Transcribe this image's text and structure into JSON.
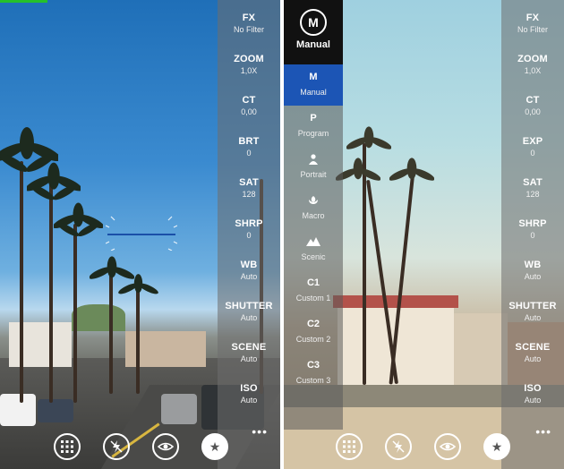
{
  "left_screen": {
    "settings": [
      {
        "label": "FX",
        "value": "No Filter"
      },
      {
        "label": "ZOOM",
        "value": "1,0X"
      },
      {
        "label": "CT",
        "value": "0,00"
      },
      {
        "label": "BRT",
        "value": "0"
      },
      {
        "label": "SAT",
        "value": "128"
      },
      {
        "label": "SHRP",
        "value": "0"
      },
      {
        "label": "WB",
        "value": "Auto"
      },
      {
        "label": "SHUTTER",
        "value": "Auto"
      },
      {
        "label": "SCENE",
        "value": "Auto"
      },
      {
        "label": "ISO",
        "value": "Auto"
      }
    ],
    "app_bar": {
      "more": "•••"
    },
    "progress_fraction": 0.17
  },
  "right_screen": {
    "mode_header": {
      "glyph": "M",
      "label": "Manual"
    },
    "modes": [
      {
        "icon": "M",
        "label": "Manual",
        "active": true
      },
      {
        "icon": "P",
        "label": "Program",
        "active": false
      },
      {
        "icon": "person-icon",
        "label": "Portrait",
        "active": false
      },
      {
        "icon": "flower-icon",
        "label": "Macro",
        "active": false
      },
      {
        "icon": "mountain-icon",
        "label": "Scenic",
        "active": false
      },
      {
        "icon": "C1",
        "label": "Custom 1",
        "active": false
      },
      {
        "icon": "C2",
        "label": "Custom 2",
        "active": false
      },
      {
        "icon": "C3",
        "label": "Custom 3",
        "active": false
      }
    ],
    "settings": [
      {
        "label": "FX",
        "value": "No Filter"
      },
      {
        "label": "ZOOM",
        "value": "1,0X"
      },
      {
        "label": "CT",
        "value": "0,00"
      },
      {
        "label": "EXP",
        "value": "0"
      },
      {
        "label": "SAT",
        "value": "128"
      },
      {
        "label": "SHRP",
        "value": "0"
      },
      {
        "label": "WB",
        "value": "Auto"
      },
      {
        "label": "SHUTTER",
        "value": "Auto"
      },
      {
        "label": "SCENE",
        "value": "Auto"
      },
      {
        "label": "ISO",
        "value": "Auto"
      }
    ],
    "app_bar": {
      "more": "•••"
    }
  },
  "colors": {
    "accent": "#1c55b5",
    "progress": "#25c12a",
    "rail": "#6e6e6e"
  }
}
